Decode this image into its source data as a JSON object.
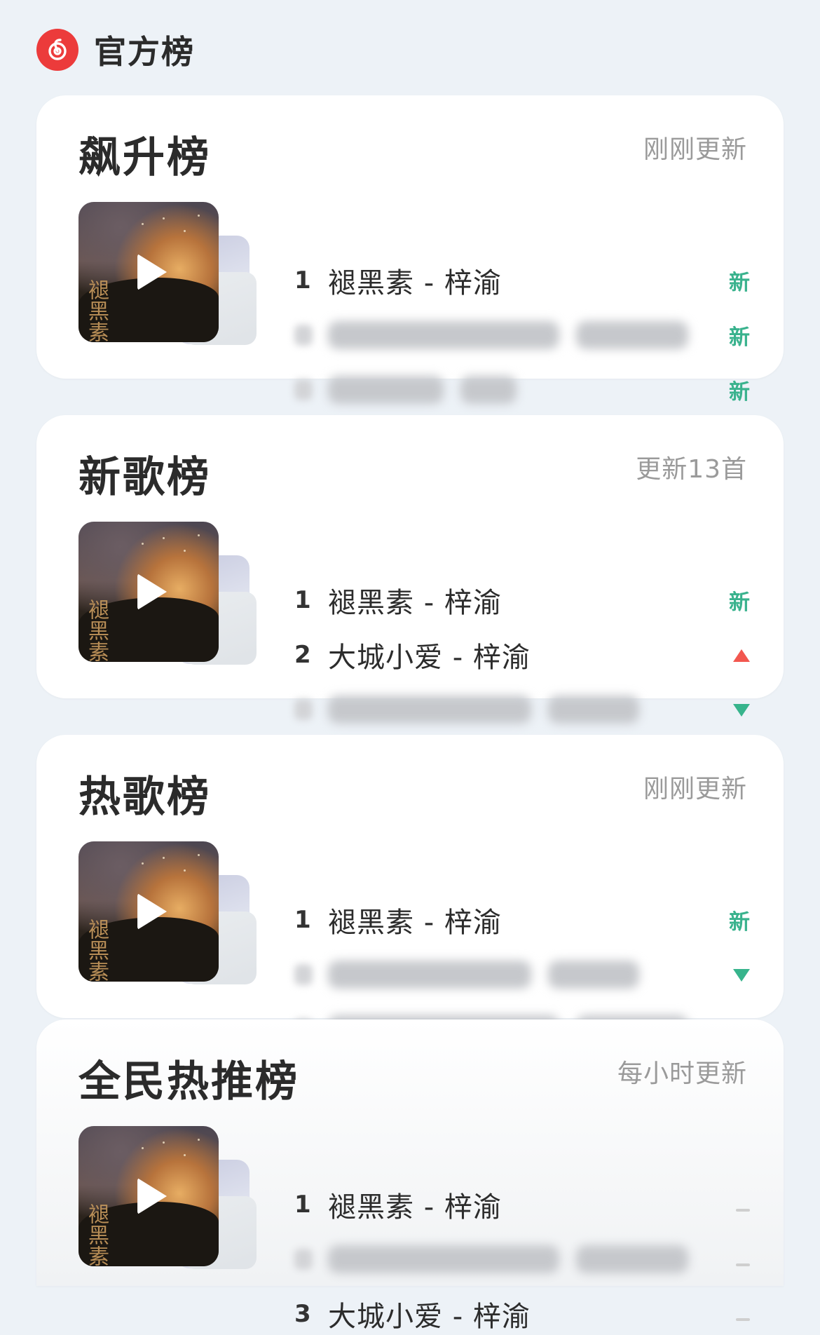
{
  "header": {
    "title": "官方榜"
  },
  "charts": [
    {
      "title": "飙升榜",
      "status": "刚刚更新",
      "rows": [
        {
          "rank": "1",
          "song": "褪黑素 - 梓渝",
          "trend": "新",
          "trend_type": "new",
          "blurred": false
        },
        {
          "blurred": true,
          "trend": "新",
          "trend_type": "new"
        },
        {
          "blurred": true,
          "trend": "新",
          "trend_type": "new"
        }
      ]
    },
    {
      "title": "新歌榜",
      "status": "更新13首",
      "rows": [
        {
          "rank": "1",
          "song": "褪黑素 - 梓渝",
          "trend": "新",
          "trend_type": "new",
          "blurred": false
        },
        {
          "rank": "2",
          "song": "大城小爱 - 梓渝",
          "trend_type": "up",
          "blurred": false
        },
        {
          "blurred": true,
          "trend_type": "down"
        }
      ]
    },
    {
      "title": "热歌榜",
      "status": "刚刚更新",
      "rows": [
        {
          "rank": "1",
          "song": "褪黑素 - 梓渝",
          "trend": "新",
          "trend_type": "new",
          "blurred": false
        },
        {
          "blurred": true,
          "trend_type": "down"
        },
        {
          "blurred": true,
          "trend_type": "down"
        }
      ]
    },
    {
      "title": "全民热推榜",
      "status": "每小时更新",
      "rows": [
        {
          "rank": "1",
          "song": "褪黑素 - 梓渝",
          "trend_type": "flat",
          "blurred": false
        },
        {
          "blurred": true,
          "trend_type": "flat"
        },
        {
          "rank": "3",
          "song": "大城小爱 - 梓渝",
          "trend_type": "flat",
          "blurred": false
        }
      ]
    }
  ],
  "cover_art_text": "褪黑素",
  "colors": {
    "new": "#39b28d",
    "up": "#f2574f",
    "down": "#37b48c",
    "brand": "#ec3b3b"
  }
}
